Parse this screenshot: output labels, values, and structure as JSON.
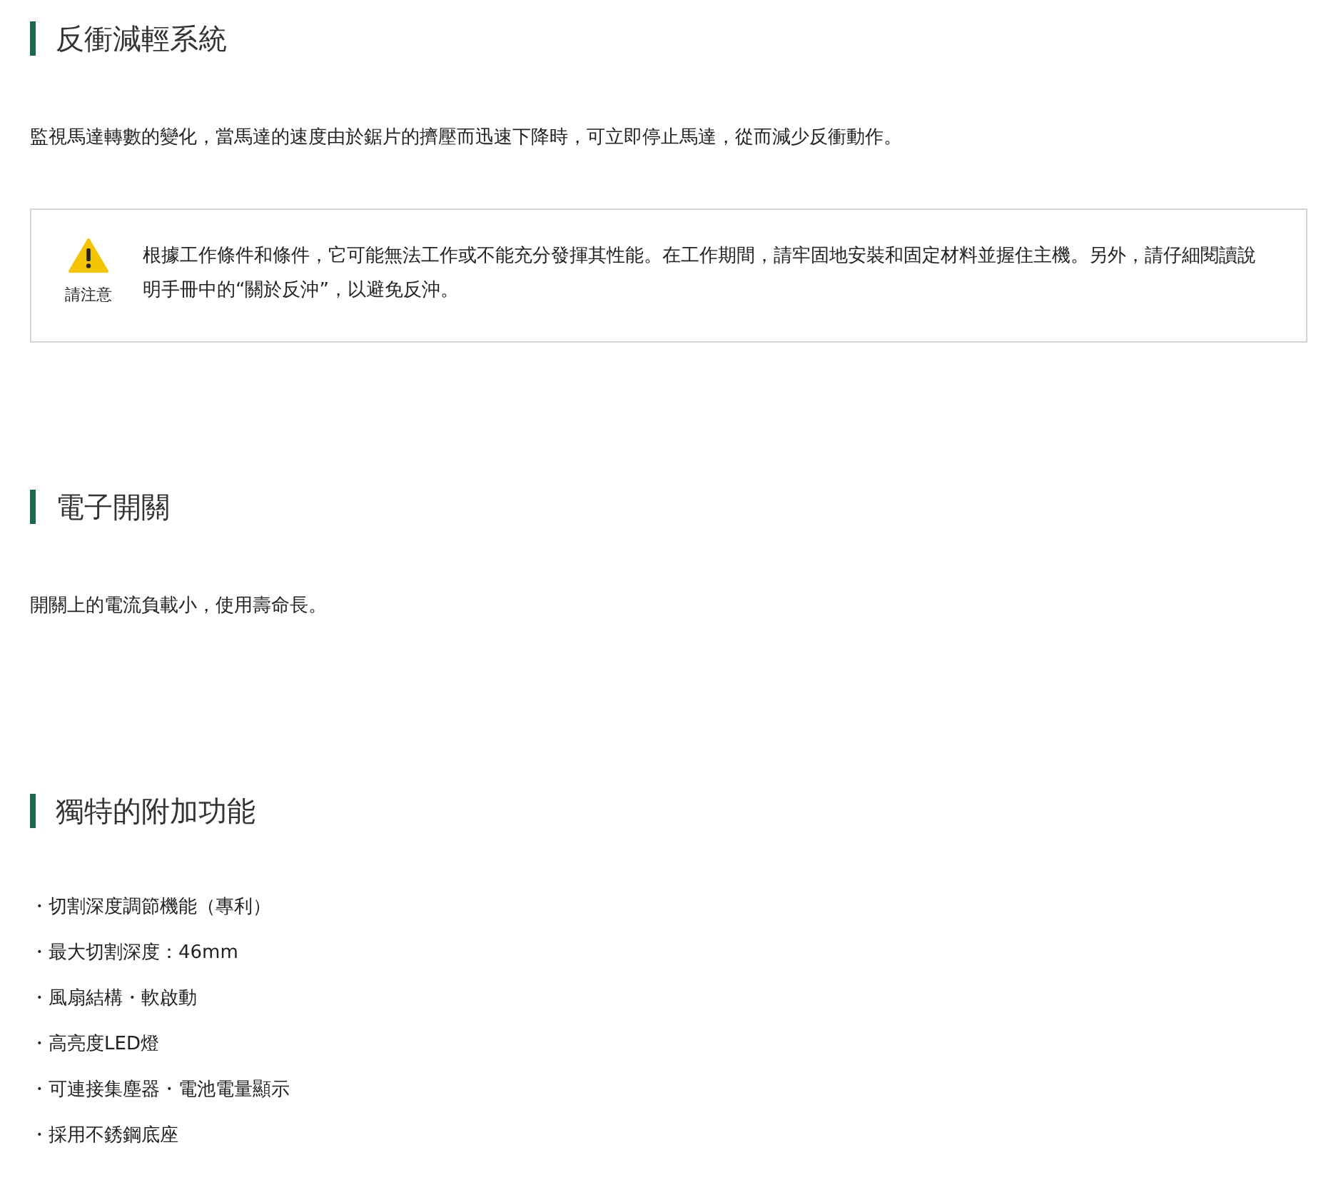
{
  "sections": [
    {
      "title": "反衝減輕系統",
      "blocks": [
        {
          "kind": "paragraph",
          "text": "監視馬達轉數的變化，當馬達的速度由於鋸片的擠壓而迅速下降時，可立即停止馬達，從而減少反衝動作。"
        },
        {
          "kind": "notice",
          "label": "請注意",
          "text": "根據工作條件和條件，它可能無法工作或不能充分發揮其性能。在工作期間，請牢固地安裝和固定材料並握住主機。另外，請仔細閱讀說明手冊中的“關於反沖”，以避免反沖。"
        }
      ]
    },
    {
      "title": "電子開關",
      "blocks": [
        {
          "kind": "paragraph",
          "text": "開關上的電流負載小，使用壽命長。"
        }
      ]
    },
    {
      "title": "獨特的附加功能",
      "blocks": [
        {
          "kind": "list",
          "items": [
            "・切割深度調節機能（專利）",
            "・最大切割深度：46mm",
            "・風扇結構・軟啟動",
            "・高亮度LED燈",
            "・可連接集塵器・電池電量顯示",
            "・採用不銹鋼底座"
          ]
        }
      ]
    }
  ]
}
